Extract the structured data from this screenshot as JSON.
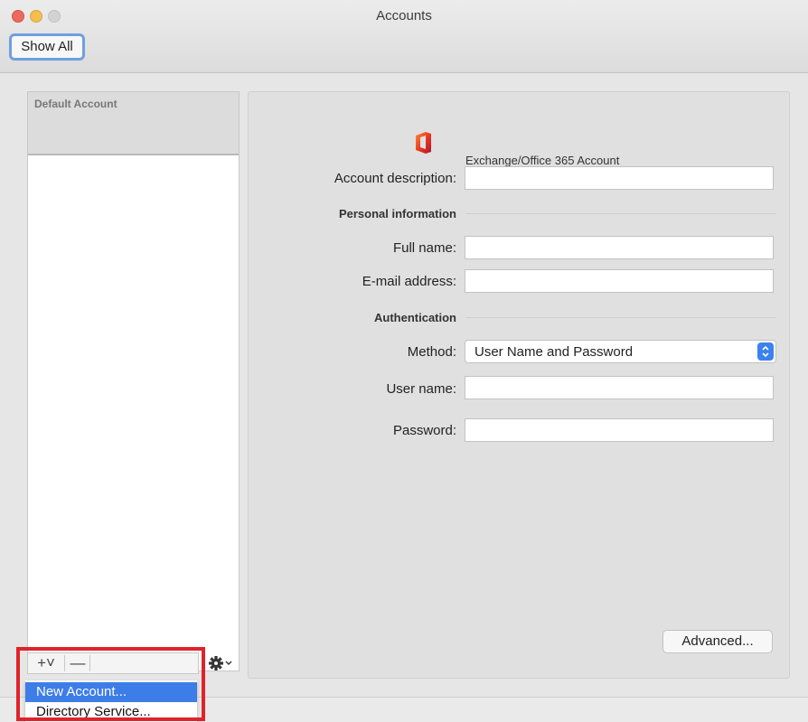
{
  "window": {
    "title": "Accounts"
  },
  "toolbar": {
    "show_all": "Show All"
  },
  "sidebar": {
    "header_label": "Default Account",
    "add_button": "+˅",
    "remove_button": "—"
  },
  "account": {
    "type": "Exchange/Office 365 Account",
    "icon": "office-logo-icon",
    "labels": {
      "description": "Account description:",
      "full_name": "Full name:",
      "email": "E-mail address:",
      "method": "Method:",
      "username": "User name:",
      "password": "Password:"
    },
    "sections": {
      "personal": "Personal information",
      "auth": "Authentication"
    },
    "values": {
      "description": "",
      "full_name": "",
      "email": "",
      "username": "",
      "password": "",
      "method": "User Name and Password"
    },
    "advanced_button": "Advanced..."
  },
  "add_menu": {
    "items": [
      "New Account...",
      "Directory Service..."
    ],
    "selected": "New Account..."
  },
  "colors": {
    "accent": "#3d7de8",
    "highlight": "#e0232a",
    "close": "#ed6a5e",
    "minimize": "#f5bf4f"
  }
}
